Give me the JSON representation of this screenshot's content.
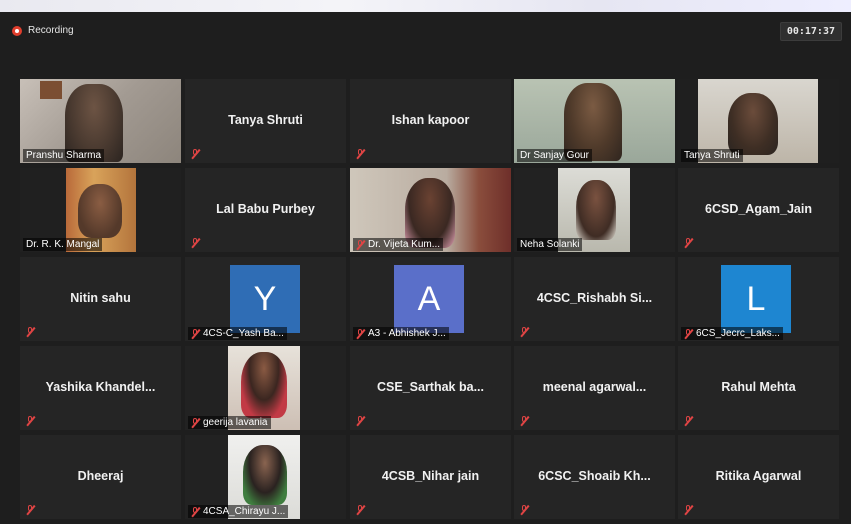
{
  "recording": {
    "label": "Recording"
  },
  "timer": "00:17:37",
  "colors": {
    "tile_bg": "#252525",
    "mute_red": "#e04444",
    "active_speaker": "#c9d44a",
    "avatar_Y": "#2f6db5",
    "avatar_A": "#5a6fc9",
    "avatar_L": "#1e86d1"
  },
  "participants": [
    {
      "name": "Pranshu Sharma",
      "display": "video"
    },
    {
      "name": "Tanya Shruti",
      "display": "name"
    },
    {
      "name": "Ishan kapoor",
      "display": "name"
    },
    {
      "name": "Dr Sanjay Gour",
      "display": "video"
    },
    {
      "name": "Tanya Shruti",
      "display": "video"
    },
    {
      "name": "Dr. R. K. Mangal",
      "display": "video"
    },
    {
      "name": "Lal Babu Purbey",
      "display": "name"
    },
    {
      "name": "Dr. Vijeta Kum...",
      "display": "video"
    },
    {
      "name": "Neha Solanki",
      "display": "video"
    },
    {
      "name": "6CSD_Agam_Jain",
      "display": "name"
    },
    {
      "name": "Nitin sahu",
      "display": "name"
    },
    {
      "name": "4CS-C_Yash Ba...",
      "display": "avatar",
      "initial": "Y"
    },
    {
      "name": "A3 - Abhishek J...",
      "display": "avatar",
      "initial": "A"
    },
    {
      "name": "4CSC_Rishabh  Si...",
      "display": "name"
    },
    {
      "name": "6CS_Jecrc_Laks...",
      "display": "avatar",
      "initial": "L"
    },
    {
      "name": "Yashika  Khandel...",
      "display": "name"
    },
    {
      "name": "geerija lavania",
      "display": "video"
    },
    {
      "name": "CSE_Sarthak  ba...",
      "display": "name"
    },
    {
      "name": "meenal  agarwal...",
      "display": "name"
    },
    {
      "name": "Rahul Mehta",
      "display": "name"
    },
    {
      "name": "Dheeraj",
      "display": "name"
    },
    {
      "name": "4CSA_Chirayu J...",
      "display": "video"
    },
    {
      "name": "4CSB_Nihar jain",
      "display": "name"
    },
    {
      "name": "6CSC_Shoaib  Kh...",
      "display": "name"
    },
    {
      "name": "Ritika Agarwal",
      "display": "name"
    }
  ]
}
